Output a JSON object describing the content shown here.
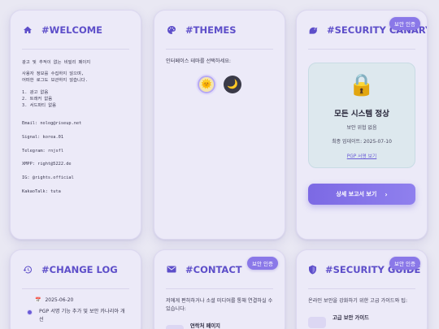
{
  "welcome": {
    "title": "#WELCOME",
    "lines": [
      "광고 및 추적이 없는 비밀리 페이지",
      "",
      "사용자 정보를 수집하지 않으며,",
      "어떠한 로그도 보관하지 않습니다.",
      "",
      "1. 광고 없음",
      "2. 트래커 없음",
      "3. 서드파티 없음"
    ],
    "contacts": [
      "Email: nolog@riseup.net",
      "Signal: korea.01",
      "Telegram: rnjsfl",
      "XMPP: right@5222.de",
      "IG: @rights.official",
      "KakaoTalk: tuta"
    ]
  },
  "themes": {
    "title": "#THEMES",
    "prompt": "인터페이스 테마를 선택하세요:",
    "light_icon": "🌞",
    "dark_icon": "🌙"
  },
  "security_canary": {
    "title": "#SECURITY CANARY",
    "badge": "보안 인증",
    "lock_icon": "🔒",
    "status_title": "모든 시스템 정상",
    "status_sub": "보안 위협 없음",
    "updated": "최종 업데이트: 2025-07-10",
    "pgp_link": "PGP 서명 보기",
    "report_button": "상세 보고서 보기",
    "report_chevron": "›"
  },
  "change_log": {
    "title": "#CHANGE LOG",
    "date_icon": "📅",
    "date": "2025-06-20",
    "entry": "PGP 서명 기능 추가 및 보안 카나리아 개선"
  },
  "contact": {
    "title": "#CONTACT",
    "badge": "보안 인증",
    "desc": "저에게 편하하거나 소셜 미디어를 통해 연결하실 수 있습니다:",
    "item_title": "연락처 페이지"
  },
  "security_guide": {
    "title": "#SECURITY GUIDE",
    "badge": "보안 인증",
    "desc": "온라인 보안을 강화하기 위한 고급 가이드와 팁:",
    "item_title": "고급 보안 가이드"
  },
  "colors": {
    "accent": "#5d4ec9",
    "badge": "#8a78e8",
    "button": "#7c69e4"
  }
}
